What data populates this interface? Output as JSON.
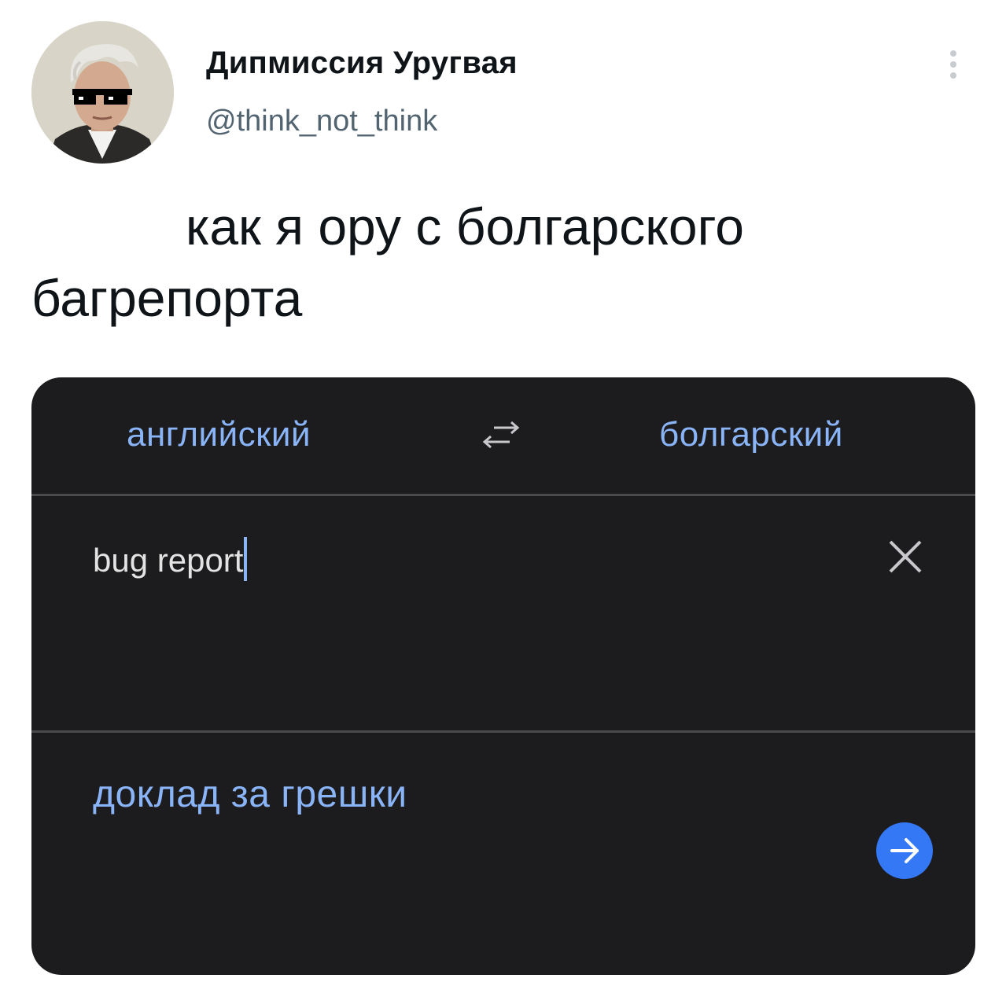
{
  "tweet": {
    "author": {
      "display_name": "Дипмиссия Уругвая",
      "handle": "@think_not_think",
      "avatar_icon": "profile-avatar"
    },
    "more_icon": "more-vertical-icon",
    "text": "как я ору с болгарского багрепорта"
  },
  "translator": {
    "source_language": "английский",
    "target_language": "болгарский",
    "swap_icon": "swap-languages-icon",
    "input_value": "bug report",
    "clear_icon": "close-icon",
    "translation": "доклад за грешки",
    "go_icon": "arrow-right-icon"
  },
  "colors": {
    "card_background": "#1c1c1e",
    "accent_blue": "#8ab4f8",
    "button_blue": "#3478f6",
    "handle_gray": "#536471"
  }
}
